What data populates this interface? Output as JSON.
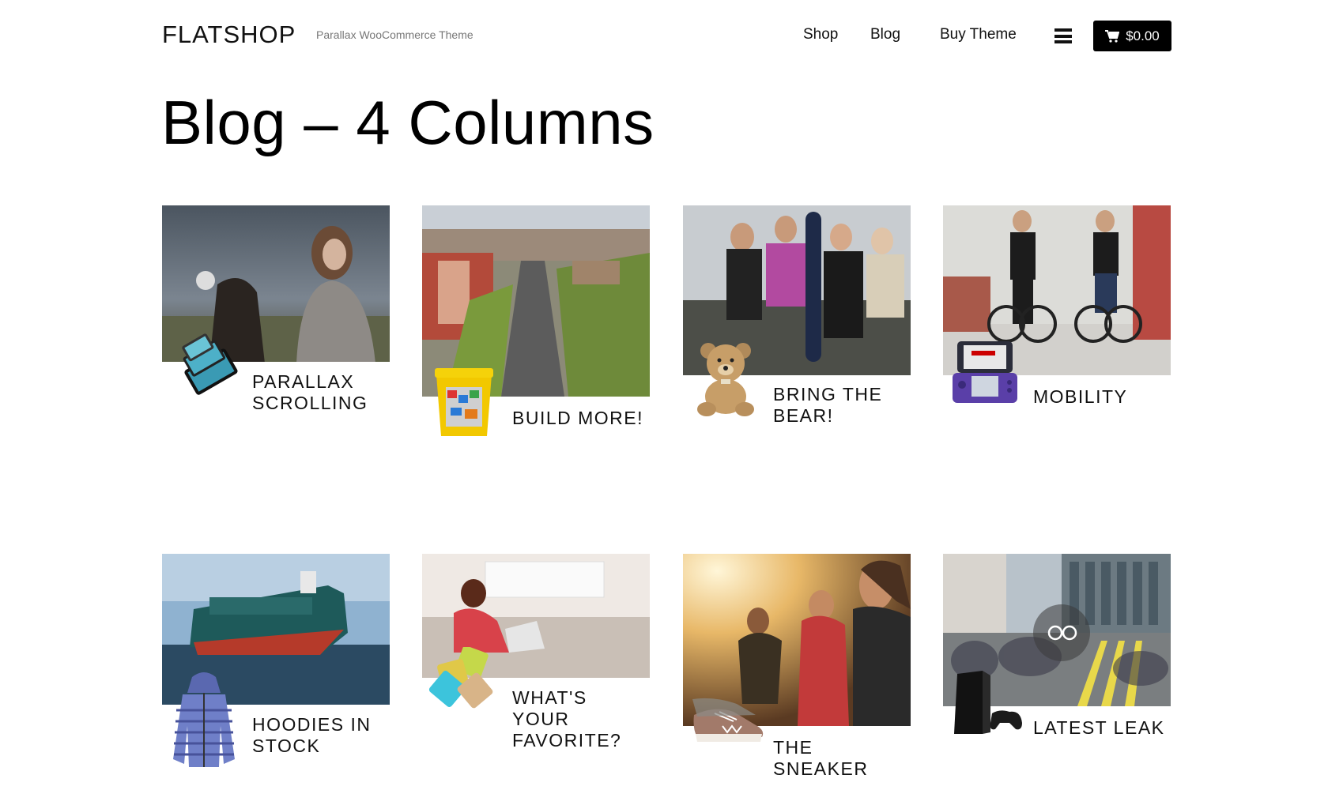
{
  "header": {
    "logo": "FLATSHOP",
    "tagline": "Parallax WooCommerce Theme",
    "nav": [
      "Shop",
      "Blog",
      "Buy Theme"
    ],
    "cart_total": "$0.00"
  },
  "page_title": "Blog – 4 Columns",
  "posts": [
    {
      "title_line1": "PARALLAX",
      "title_line2": "SCROLLING",
      "image": "woman-with-horse-photo",
      "product": "tablet-stack-icon"
    },
    {
      "title_line1": "BUILD MORE!",
      "title_line2": "",
      "image": "city-street-aerial-photo",
      "product": "lego-bucket-icon"
    },
    {
      "title_line1": "BRING THE",
      "title_line2": "BEAR!",
      "image": "subway-passengers-photo",
      "product": "teddy-bear-icon"
    },
    {
      "title_line1": "MOBILITY",
      "title_line2": "",
      "image": "cyclists-photo",
      "product": "handheld-console-icon"
    },
    {
      "title_line1": "HOODIES IN",
      "title_line2": "STOCK",
      "image": "cargo-ship-photo",
      "product": "hoodie-icon"
    },
    {
      "title_line1": "WHAT'S YOUR",
      "title_line2": "FAVORITE?",
      "image": "girl-with-laptop-photo",
      "product": "pillows-icon"
    },
    {
      "title_line1": "THE SNEAKER",
      "title_line2": "",
      "image": "sunlit-friends-photo",
      "product": "sneaker-icon"
    },
    {
      "title_line1": "LATEST LEAK",
      "title_line2": "",
      "image": "busy-crossing-photo",
      "product": "game-console-icon"
    }
  ]
}
